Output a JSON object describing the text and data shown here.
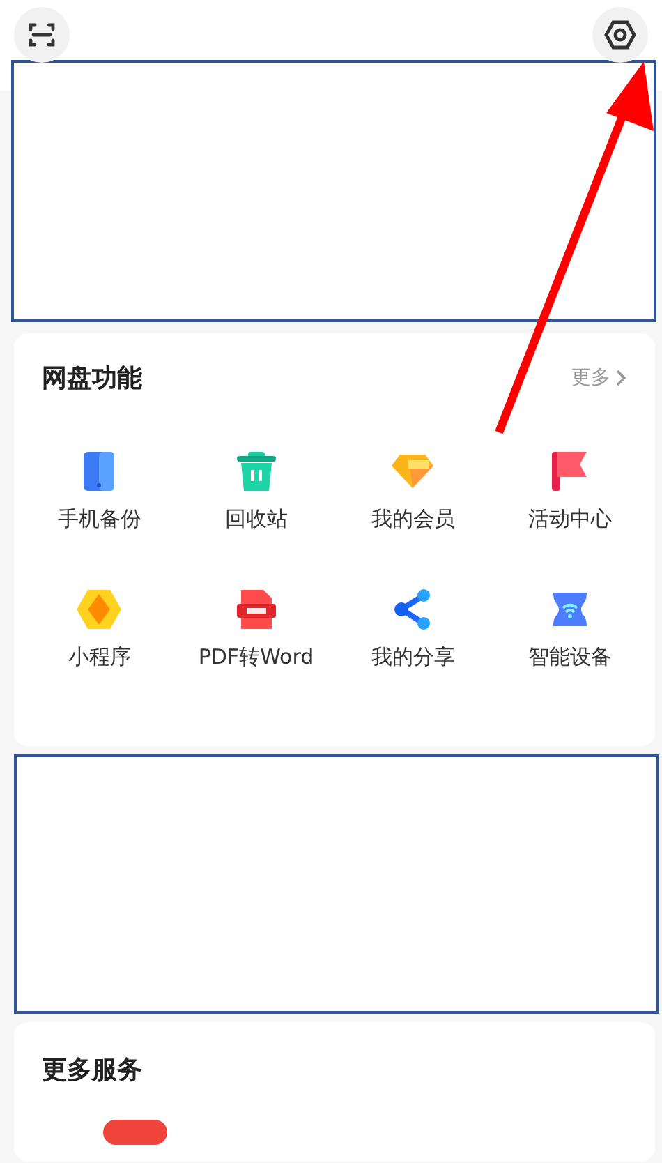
{
  "features": {
    "title": "网盘功能",
    "more": "更多",
    "items": [
      {
        "label": "手机备份"
      },
      {
        "label": "回收站"
      },
      {
        "label": "我的会员"
      },
      {
        "label": "活动中心"
      },
      {
        "label": "小程序"
      },
      {
        "label": "PDF转Word"
      },
      {
        "label": "我的分享"
      },
      {
        "label": "智能设备"
      }
    ]
  },
  "more_services": {
    "title": "更多服务"
  }
}
